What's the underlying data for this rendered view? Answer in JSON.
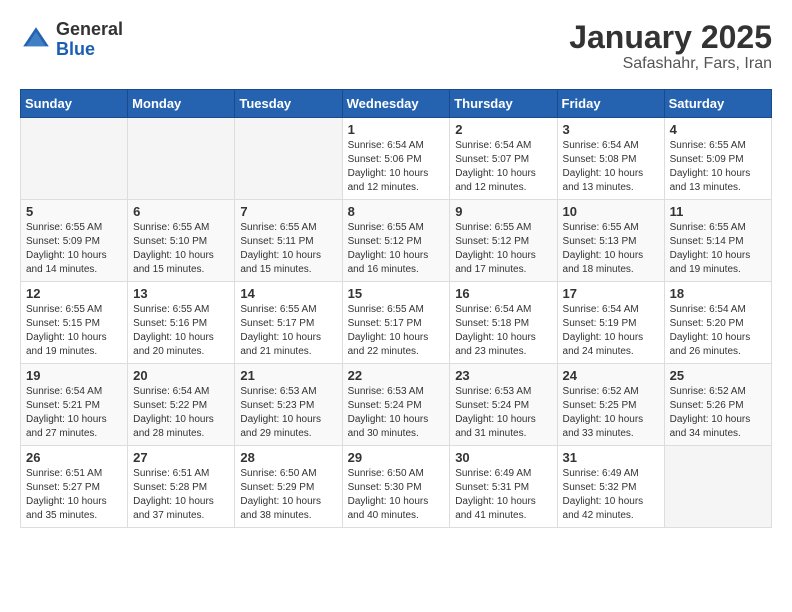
{
  "logo": {
    "general": "General",
    "blue": "Blue"
  },
  "title": "January 2025",
  "subtitle": "Safashahr, Fars, Iran",
  "days_header": [
    "Sunday",
    "Monday",
    "Tuesday",
    "Wednesday",
    "Thursday",
    "Friday",
    "Saturday"
  ],
  "weeks": [
    [
      {
        "day": "",
        "info": ""
      },
      {
        "day": "",
        "info": ""
      },
      {
        "day": "",
        "info": ""
      },
      {
        "day": "1",
        "info": "Sunrise: 6:54 AM\nSunset: 5:06 PM\nDaylight: 10 hours\nand 12 minutes."
      },
      {
        "day": "2",
        "info": "Sunrise: 6:54 AM\nSunset: 5:07 PM\nDaylight: 10 hours\nand 12 minutes."
      },
      {
        "day": "3",
        "info": "Sunrise: 6:54 AM\nSunset: 5:08 PM\nDaylight: 10 hours\nand 13 minutes."
      },
      {
        "day": "4",
        "info": "Sunrise: 6:55 AM\nSunset: 5:09 PM\nDaylight: 10 hours\nand 13 minutes."
      }
    ],
    [
      {
        "day": "5",
        "info": "Sunrise: 6:55 AM\nSunset: 5:09 PM\nDaylight: 10 hours\nand 14 minutes."
      },
      {
        "day": "6",
        "info": "Sunrise: 6:55 AM\nSunset: 5:10 PM\nDaylight: 10 hours\nand 15 minutes."
      },
      {
        "day": "7",
        "info": "Sunrise: 6:55 AM\nSunset: 5:11 PM\nDaylight: 10 hours\nand 15 minutes."
      },
      {
        "day": "8",
        "info": "Sunrise: 6:55 AM\nSunset: 5:12 PM\nDaylight: 10 hours\nand 16 minutes."
      },
      {
        "day": "9",
        "info": "Sunrise: 6:55 AM\nSunset: 5:12 PM\nDaylight: 10 hours\nand 17 minutes."
      },
      {
        "day": "10",
        "info": "Sunrise: 6:55 AM\nSunset: 5:13 PM\nDaylight: 10 hours\nand 18 minutes."
      },
      {
        "day": "11",
        "info": "Sunrise: 6:55 AM\nSunset: 5:14 PM\nDaylight: 10 hours\nand 19 minutes."
      }
    ],
    [
      {
        "day": "12",
        "info": "Sunrise: 6:55 AM\nSunset: 5:15 PM\nDaylight: 10 hours\nand 19 minutes."
      },
      {
        "day": "13",
        "info": "Sunrise: 6:55 AM\nSunset: 5:16 PM\nDaylight: 10 hours\nand 20 minutes."
      },
      {
        "day": "14",
        "info": "Sunrise: 6:55 AM\nSunset: 5:17 PM\nDaylight: 10 hours\nand 21 minutes."
      },
      {
        "day": "15",
        "info": "Sunrise: 6:55 AM\nSunset: 5:17 PM\nDaylight: 10 hours\nand 22 minutes."
      },
      {
        "day": "16",
        "info": "Sunrise: 6:54 AM\nSunset: 5:18 PM\nDaylight: 10 hours\nand 23 minutes."
      },
      {
        "day": "17",
        "info": "Sunrise: 6:54 AM\nSunset: 5:19 PM\nDaylight: 10 hours\nand 24 minutes."
      },
      {
        "day": "18",
        "info": "Sunrise: 6:54 AM\nSunset: 5:20 PM\nDaylight: 10 hours\nand 26 minutes."
      }
    ],
    [
      {
        "day": "19",
        "info": "Sunrise: 6:54 AM\nSunset: 5:21 PM\nDaylight: 10 hours\nand 27 minutes."
      },
      {
        "day": "20",
        "info": "Sunrise: 6:54 AM\nSunset: 5:22 PM\nDaylight: 10 hours\nand 28 minutes."
      },
      {
        "day": "21",
        "info": "Sunrise: 6:53 AM\nSunset: 5:23 PM\nDaylight: 10 hours\nand 29 minutes."
      },
      {
        "day": "22",
        "info": "Sunrise: 6:53 AM\nSunset: 5:24 PM\nDaylight: 10 hours\nand 30 minutes."
      },
      {
        "day": "23",
        "info": "Sunrise: 6:53 AM\nSunset: 5:24 PM\nDaylight: 10 hours\nand 31 minutes."
      },
      {
        "day": "24",
        "info": "Sunrise: 6:52 AM\nSunset: 5:25 PM\nDaylight: 10 hours\nand 33 minutes."
      },
      {
        "day": "25",
        "info": "Sunrise: 6:52 AM\nSunset: 5:26 PM\nDaylight: 10 hours\nand 34 minutes."
      }
    ],
    [
      {
        "day": "26",
        "info": "Sunrise: 6:51 AM\nSunset: 5:27 PM\nDaylight: 10 hours\nand 35 minutes."
      },
      {
        "day": "27",
        "info": "Sunrise: 6:51 AM\nSunset: 5:28 PM\nDaylight: 10 hours\nand 37 minutes."
      },
      {
        "day": "28",
        "info": "Sunrise: 6:50 AM\nSunset: 5:29 PM\nDaylight: 10 hours\nand 38 minutes."
      },
      {
        "day": "29",
        "info": "Sunrise: 6:50 AM\nSunset: 5:30 PM\nDaylight: 10 hours\nand 40 minutes."
      },
      {
        "day": "30",
        "info": "Sunrise: 6:49 AM\nSunset: 5:31 PM\nDaylight: 10 hours\nand 41 minutes."
      },
      {
        "day": "31",
        "info": "Sunrise: 6:49 AM\nSunset: 5:32 PM\nDaylight: 10 hours\nand 42 minutes."
      },
      {
        "day": "",
        "info": ""
      }
    ]
  ]
}
